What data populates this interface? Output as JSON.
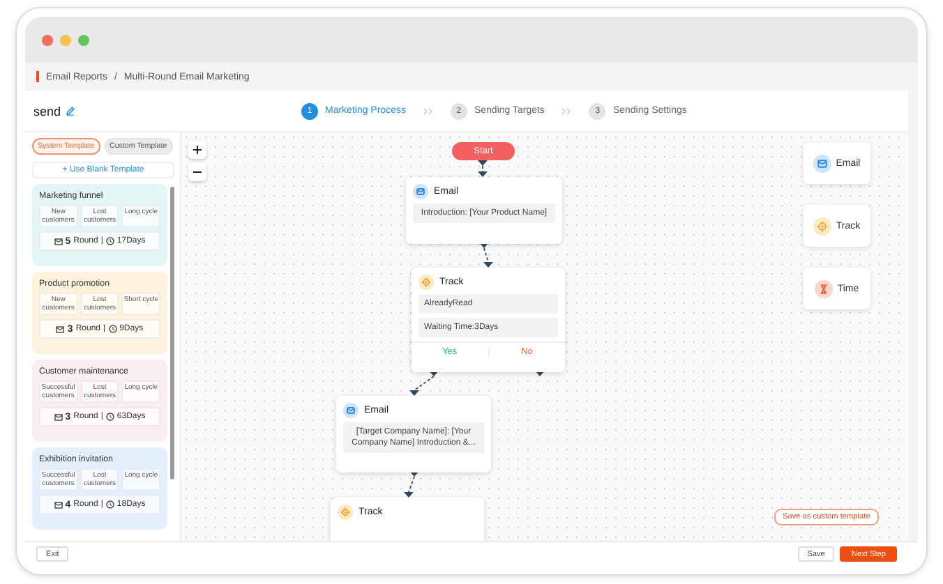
{
  "browser": {
    "dots": [
      {
        "color": "#f26b5b"
      },
      {
        "color": "#f5c04f"
      },
      {
        "color": "#5fc65e"
      }
    ]
  },
  "breadcrumb": {
    "items": [
      "Email Reports",
      "Multi-Round Email Marketing"
    ],
    "separator": "/"
  },
  "title": "send",
  "steps": [
    {
      "number": "1",
      "label": "Marketing Process",
      "selected": true
    },
    {
      "number": "2",
      "label": "Sending Targets",
      "selected": false
    },
    {
      "number": "3",
      "label": "Sending Settings",
      "selected": false
    }
  ],
  "sidebar": {
    "tabs": [
      {
        "label": "System Template",
        "selected": true
      },
      {
        "label": "Custom Template",
        "selected": false
      }
    ],
    "blank_button": "+ Use Blank Template",
    "templates": [
      {
        "title": "Marketing funnel",
        "color": "#e3f6f3",
        "tags": [
          "New customers",
          "Lost customers",
          "Long cycle"
        ],
        "rounds": "5",
        "round_unit": "Round",
        "separator": "|",
        "days": "17Days"
      },
      {
        "title": "Product promotion",
        "color": "#fdf3dc",
        "tags": [
          "New customers",
          "Lost customers",
          "Short cycle"
        ],
        "rounds": "3",
        "round_unit": "Round",
        "separator": "|",
        "days": "9Days"
      },
      {
        "title": "Customer maintenance",
        "color": "#fbeef3",
        "tags": [
          "Successful customers",
          "Lost customers",
          "Long cycle"
        ],
        "rounds": "3",
        "round_unit": "Round",
        "separator": "|",
        "days": "63Days"
      },
      {
        "title": "Exhibition invitation",
        "color": "#e3f0fb",
        "tags": [
          "Successful customers",
          "Lost customers",
          "Long cycle"
        ],
        "rounds": "4",
        "round_unit": "Round",
        "separator": "|",
        "days": "18Days"
      }
    ]
  },
  "canvas": {
    "nodes": [
      {
        "kind": "start",
        "label": "Start"
      },
      {
        "kind": "email",
        "label": "Email",
        "rows": [
          "Introduction: [Your Product Name]"
        ]
      },
      {
        "kind": "track",
        "label": "Track",
        "rows": [
          "AlreadyRead",
          "Waiting Time:3Days"
        ],
        "branches": [
          {
            "label": "Yes",
            "color": "#1fb5a8"
          },
          {
            "label": "No",
            "color": "#e8693a"
          }
        ]
      },
      {
        "kind": "email",
        "label": "Email",
        "rows": [
          "[Target Company Name]: [Your Company Name] Introduction &..."
        ]
      },
      {
        "kind": "track",
        "label": "Track"
      }
    ],
    "palette": [
      {
        "kind": "email",
        "label": "Email"
      },
      {
        "kind": "track",
        "label": "Track"
      },
      {
        "kind": "time",
        "label": "Time"
      }
    ],
    "save_template": "Save as custom template"
  },
  "footer": {
    "exit": "Exit",
    "save": "Save",
    "next": "Next Step"
  }
}
